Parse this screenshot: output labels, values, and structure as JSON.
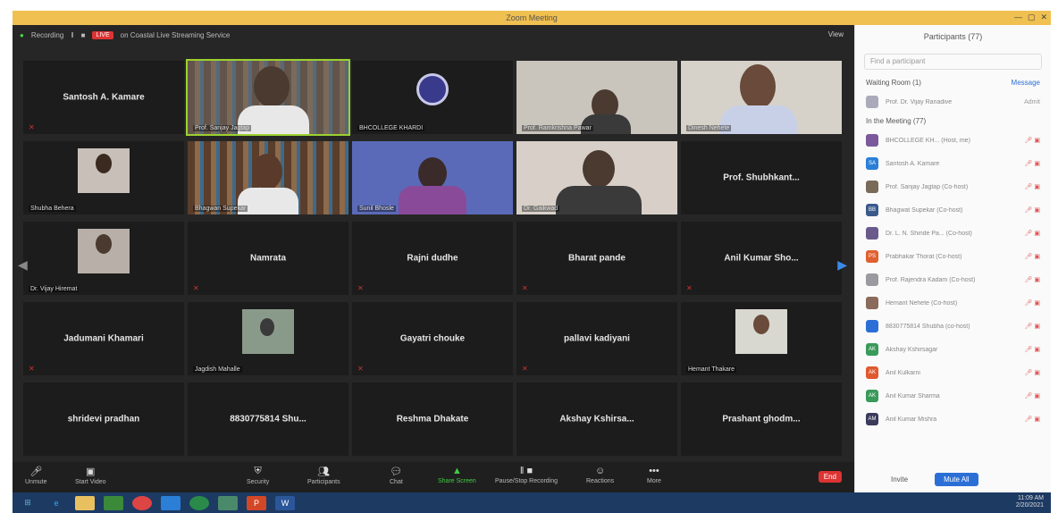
{
  "window": {
    "title": "Zoom Meeting"
  },
  "topbar": {
    "recording": "Recording",
    "live": "LIVE",
    "live_text": "on Coastal Live Streaming Service",
    "view": "View"
  },
  "tiles": [
    {
      "name": "Santosh A. Kamare",
      "label": ""
    },
    {
      "name": "",
      "label": "Prof. Sanjay Jagtap"
    },
    {
      "name": "",
      "label": "BHCOLLEGE KHARDI"
    },
    {
      "name": "",
      "label": "Prof. Ramkrishna Pawar"
    },
    {
      "name": "",
      "label": "Dinesh Nehete"
    },
    {
      "name": "",
      "label": "Shubha Behera"
    },
    {
      "name": "",
      "label": "Bhagwan Supekar"
    },
    {
      "name": "",
      "label": "Sunil Bhosle"
    },
    {
      "name": "",
      "label": "Dr. Gaikwad"
    },
    {
      "name": "Prof. Shubhkant...",
      "label": ""
    },
    {
      "name": "",
      "label": "Dr. Vijay Hiremat"
    },
    {
      "name": "Namrata",
      "label": ""
    },
    {
      "name": "Rajni dudhe",
      "label": ""
    },
    {
      "name": "Bharat pande",
      "label": ""
    },
    {
      "name": "Anil Kumar Sho...",
      "label": ""
    },
    {
      "name": "Jadumani Khamari",
      "label": ""
    },
    {
      "name": "",
      "label": "Jagdish Mahalle"
    },
    {
      "name": "Gayatri chouke",
      "label": ""
    },
    {
      "name": "pallavi kadiyani",
      "label": ""
    },
    {
      "name": "",
      "label": "Hemant Thakare"
    },
    {
      "name": "shridevi pradhan",
      "label": ""
    },
    {
      "name": "8830775814 Shu...",
      "label": ""
    },
    {
      "name": "Reshma Dhakate",
      "label": ""
    },
    {
      "name": "Akshay Kshirsa...",
      "label": ""
    },
    {
      "name": "Prashant ghodm...",
      "label": ""
    }
  ],
  "footer": {
    "mute": "Unmute",
    "video": "Start Video",
    "security": "Security",
    "participants": "Participants",
    "chat": "Chat",
    "share": "Share Screen",
    "record": "Pause/Stop Recording",
    "reactions": "Reactions",
    "more": "More",
    "end": "End"
  },
  "panel": {
    "title": "Participants (77)",
    "search_placeholder": "Find a participant",
    "waiting": "Waiting Room (1)",
    "waiting_action": "Message",
    "waiting_person": "Prof. Dr. Vijay Ranadive",
    "waiting_admit": "Admit",
    "in_meeting": "In the Meeting (77)",
    "participants": [
      {
        "initials": "",
        "name": "BHCOLLEGE KH... (Host, me)",
        "color": "#7a5a9a"
      },
      {
        "initials": "SA",
        "name": "Santosh A. Kamare",
        "color": "#2b7fd6"
      },
      {
        "initials": "",
        "name": "Prof. Sanjay Jagtap (Co-host)",
        "color": "#7a6a5a"
      },
      {
        "initials": "BB",
        "name": "Bhagwat Supekar (Co-host)",
        "color": "#3a5a8c"
      },
      {
        "initials": "",
        "name": "Dr. L. N. Shinde Pa... (Co-host)",
        "color": "#6a5a8c"
      },
      {
        "initials": "PS",
        "name": "Prabhakar Thorat (Co-host)",
        "color": "#e06030"
      },
      {
        "initials": "",
        "name": "Prof. Rajendra Kadam (Co-host)",
        "color": "#9a9aa0"
      },
      {
        "initials": "",
        "name": "Hemant Nehete (Co-host)",
        "color": "#8a6a5a"
      },
      {
        "initials": "",
        "name": "8830775814 Shubha (co-host)",
        "color": "#2b6fd6"
      },
      {
        "initials": "AK",
        "name": "Akshay Kshirsagar",
        "color": "#3a9a5a"
      },
      {
        "initials": "AK",
        "name": "Anil Kulkarni",
        "color": "#e05a30"
      },
      {
        "initials": "AK",
        "name": "Anil Kumar Sharma",
        "color": "#3a9a5a"
      },
      {
        "initials": "AM",
        "name": "Anil Kumar Mishra",
        "color": "#3a3a5a"
      }
    ],
    "invite": "Invite",
    "mute_all": "Mute All"
  },
  "taskbar": {
    "time": "11:09 AM",
    "date": "2/20/2021"
  }
}
